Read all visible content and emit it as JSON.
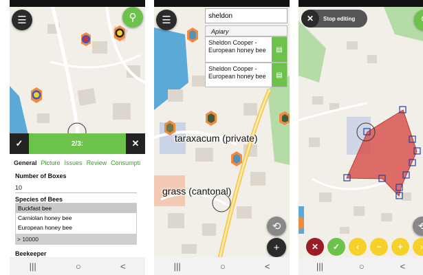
{
  "screen1": {
    "counter": "2/3:",
    "confirm_icon": "check-icon",
    "close_icon": "close-icon",
    "tabs": [
      "General",
      "Picture",
      "Issues",
      "Review",
      "Consumpti"
    ],
    "num_boxes_label": "Number of Boxes",
    "num_boxes_value": "10",
    "species_label": "Species of Bees",
    "species_options": [
      "Buckfast bee",
      "Carniolan honey bee",
      "European honey bee"
    ],
    "size_value": "> 10000",
    "beekeeper_label": "Beekeeper"
  },
  "screen2": {
    "search_value": "sheldon",
    "category": "Apiary",
    "results": [
      "Sheldon Cooper - European honey bee",
      "Sheldon Cooper - European honey bee"
    ],
    "labels": [
      "taraxacum (private)",
      "grass (cantonal)"
    ]
  },
  "screen3": {
    "stop_label": "Stop editing"
  },
  "colors": {
    "green": "#6cc24a",
    "dark": "#2b2b2b",
    "orange": "#f08a3c",
    "yellow": "#f5d12a",
    "red_polygon": "#d9534f",
    "water": "#5aa9d6"
  }
}
